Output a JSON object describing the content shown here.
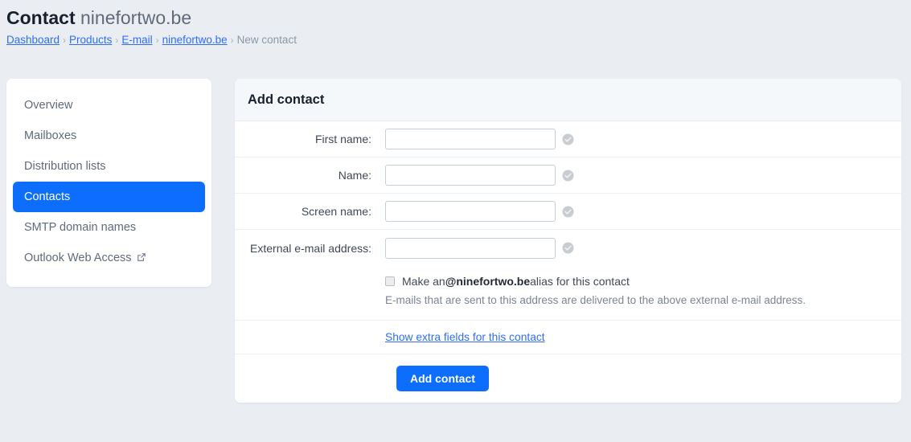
{
  "header": {
    "title_strong": "Contact",
    "title_rest": "ninefortwo.be",
    "breadcrumb": [
      {
        "label": "Dashboard",
        "type": "link"
      },
      {
        "label": "Products",
        "type": "link"
      },
      {
        "label": "E-mail",
        "type": "link"
      },
      {
        "label": "ninefortwo.be",
        "type": "link"
      },
      {
        "label": "New contact",
        "type": "current"
      }
    ],
    "separator": "›"
  },
  "sidebar": {
    "items": [
      {
        "label": "Overview",
        "active": false,
        "external": false
      },
      {
        "label": "Mailboxes",
        "active": false,
        "external": false
      },
      {
        "label": "Distribution lists",
        "active": false,
        "external": false
      },
      {
        "label": "Contacts",
        "active": true,
        "external": false
      },
      {
        "label": "SMTP domain names",
        "active": false,
        "external": false
      },
      {
        "label": "Outlook Web Access",
        "active": false,
        "external": true
      }
    ]
  },
  "card": {
    "title": "Add contact",
    "fields": [
      {
        "label": "First name:",
        "value": "",
        "placeholder": ""
      },
      {
        "label": "Name:",
        "value": "",
        "placeholder": ""
      },
      {
        "label": "Screen name:",
        "value": "",
        "placeholder": ""
      },
      {
        "label": "External e-mail address:",
        "value": "",
        "placeholder": ""
      }
    ],
    "alias": {
      "checked": false,
      "text_before": "Make an ",
      "domain": "@ninefortwo.be",
      "text_after": " alias for this contact",
      "help": "E-mails that are sent to this address are delivered to the above external e-mail address."
    },
    "extra_fields_link": "Show extra fields for this contact",
    "submit_label": "Add contact"
  },
  "colors": {
    "accent": "#0d6efd",
    "link": "#2f6df6",
    "page_bg": "#eaeef3",
    "card_bg": "#ffffff",
    "card_header_bg": "#f5f8fb",
    "muted_text": "#7b8593"
  }
}
